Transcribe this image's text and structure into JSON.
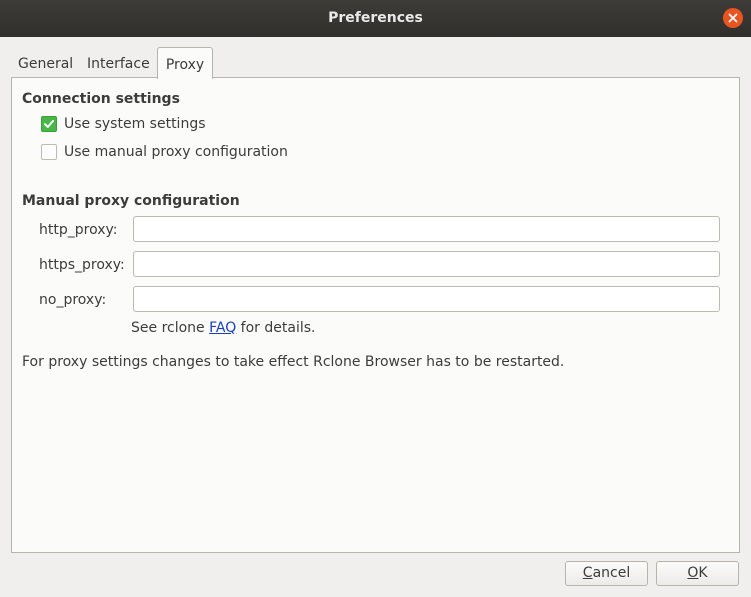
{
  "window": {
    "title": "Preferences",
    "close_icon": "close-icon"
  },
  "tabs": [
    {
      "label": "General",
      "active": false
    },
    {
      "label": "Interface",
      "active": false
    },
    {
      "label": "Proxy",
      "active": true
    }
  ],
  "connection_settings": {
    "heading": "Connection settings",
    "options": [
      {
        "label": "Use system settings",
        "checked": true
      },
      {
        "label": "Use manual proxy configuration",
        "checked": false
      }
    ]
  },
  "manual_proxy": {
    "heading": "Manual proxy configuration",
    "fields": [
      {
        "label": "http_proxy:",
        "value": ""
      },
      {
        "label": "https_proxy:",
        "value": ""
      },
      {
        "label": "no_proxy:",
        "value": ""
      }
    ],
    "help_prefix": "See rclone ",
    "help_link": "FAQ",
    "help_suffix": " for details."
  },
  "restart_note": "For proxy settings changes to take effect Rclone Browser has to be restarted.",
  "buttons": {
    "cancel_mnemonic": "C",
    "cancel_rest": "ancel",
    "ok_mnemonic": "O",
    "ok_rest": "K"
  },
  "colors": {
    "accent_close": "#e95420",
    "checkbox_checked": "#48b748",
    "link": "#1a3fbd"
  }
}
